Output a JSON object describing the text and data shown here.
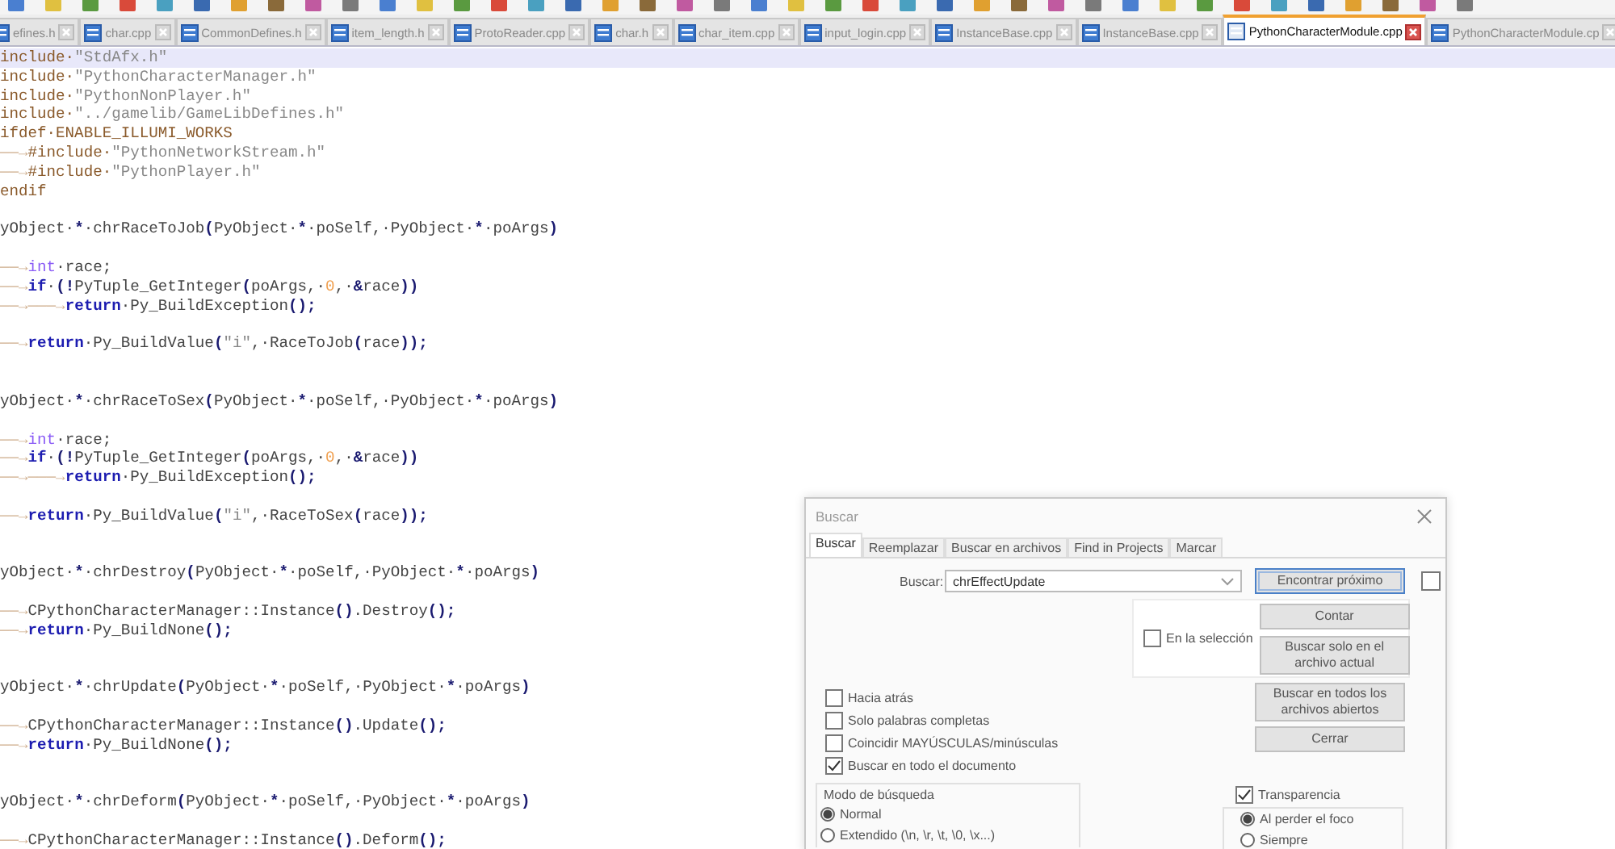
{
  "tabs": [
    {
      "label": "efines.h",
      "selected": false
    },
    {
      "label": "char.cpp",
      "selected": false
    },
    {
      "label": "CommonDefines.h",
      "selected": false
    },
    {
      "label": "item_length.h",
      "selected": false
    },
    {
      "label": "ProtoReader.cpp",
      "selected": false
    },
    {
      "label": "char.h",
      "selected": false
    },
    {
      "label": "char_item.cpp",
      "selected": false
    },
    {
      "label": "input_login.cpp",
      "selected": false
    },
    {
      "label": "InstanceBase.cpp",
      "selected": false
    },
    {
      "label": "InstanceBase.cpp",
      "selected": false
    },
    {
      "label": "PythonCharacterModule.cpp",
      "selected": true
    },
    {
      "label": "PythonCharacterModule.cp",
      "selected": false
    }
  ],
  "code_blocks": [
    {
      "kind": "preprocessor",
      "lines": [
        {
          "current": true,
          "tokens": [
            {
              "kind": "pp",
              "text": "include·"
            },
            {
              "kind": "str",
              "text": "\"StdAfx.h\""
            }
          ]
        },
        {
          "current": false,
          "tokens": [
            {
              "kind": "pp",
              "text": "include·"
            },
            {
              "kind": "str",
              "text": "\"PythonCharacterManager.h\""
            }
          ]
        },
        {
          "current": false,
          "tokens": [
            {
              "kind": "pp",
              "text": "include·"
            },
            {
              "kind": "str",
              "text": "\"PythonNonPlayer.h\""
            }
          ]
        },
        {
          "current": false,
          "tokens": [
            {
              "kind": "pp",
              "text": "include·"
            },
            {
              "kind": "str",
              "text": "\"../gamelib/GameLibDefines.h\""
            }
          ]
        },
        {
          "current": false,
          "tokens": [
            {
              "kind": "pp",
              "text": "ifdef·ENABLE_ILLUMI_WORKS"
            }
          ]
        },
        {
          "current": false,
          "tokens": [
            {
              "kind": "ws",
              "text": "——→"
            },
            {
              "kind": "pp",
              "text": "#include·"
            },
            {
              "kind": "str",
              "text": "\"PythonNetworkStream.h\""
            }
          ]
        },
        {
          "current": false,
          "tokens": [
            {
              "kind": "ws",
              "text": "——→"
            },
            {
              "kind": "pp",
              "text": "#include·"
            },
            {
              "kind": "str",
              "text": "\"PythonPlayer.h\""
            }
          ]
        },
        {
          "current": false,
          "tokens": [
            {
              "kind": "pp",
              "text": "endif"
            }
          ]
        }
      ]
    },
    {
      "kind": "signature",
      "lines": [
        {
          "current": false,
          "tokens": [
            {
              "kind": "text",
              "text": "yObject·"
            },
            {
              "kind": "op",
              "text": "*"
            },
            {
              "kind": "text",
              "text": "·chrRaceToJob"
            },
            {
              "kind": "op",
              "text": "("
            },
            {
              "kind": "text",
              "text": "PyObject·"
            },
            {
              "kind": "op",
              "text": "*"
            },
            {
              "kind": "text",
              "text": "·poSelf,·PyObject·"
            },
            {
              "kind": "op",
              "text": "*"
            },
            {
              "kind": "text",
              "text": "·poArgs"
            },
            {
              "kind": "op",
              "text": ")"
            }
          ]
        }
      ]
    },
    {
      "kind": "body",
      "lines": [
        {
          "current": false,
          "tokens": [
            {
              "kind": "ws",
              "text": "——→"
            },
            {
              "kind": "type",
              "text": "int"
            },
            {
              "kind": "text",
              "text": "·race;"
            }
          ]
        },
        {
          "current": false,
          "tokens": [
            {
              "kind": "ws",
              "text": "——→"
            },
            {
              "kind": "kw",
              "text": "if"
            },
            {
              "kind": "text",
              "text": "·"
            },
            {
              "kind": "op",
              "text": "(!"
            },
            {
              "kind": "text",
              "text": "PyTuple_GetInteger"
            },
            {
              "kind": "op",
              "text": "("
            },
            {
              "kind": "text",
              "text": "poArgs,·"
            },
            {
              "kind": "num",
              "text": "0"
            },
            {
              "kind": "text",
              "text": ",·"
            },
            {
              "kind": "op",
              "text": "&"
            },
            {
              "kind": "text",
              "text": "race"
            },
            {
              "kind": "op",
              "text": "))"
            }
          ]
        },
        {
          "current": false,
          "tokens": [
            {
              "kind": "ws",
              "text": "——→———→"
            },
            {
              "kind": "kw",
              "text": "return"
            },
            {
              "kind": "text",
              "text": "·Py_BuildException"
            },
            {
              "kind": "op",
              "text": "();"
            }
          ]
        }
      ]
    },
    {
      "kind": "body",
      "lines": [
        {
          "current": false,
          "tokens": [
            {
              "kind": "ws",
              "text": "——→"
            },
            {
              "kind": "kw",
              "text": "return"
            },
            {
              "kind": "text",
              "text": "·Py_BuildValue"
            },
            {
              "kind": "op",
              "text": "("
            },
            {
              "kind": "str",
              "text": "\"i\""
            },
            {
              "kind": "text",
              "text": ",·RaceToJob"
            },
            {
              "kind": "op",
              "text": "("
            },
            {
              "kind": "text",
              "text": "race"
            },
            {
              "kind": "op",
              "text": "));"
            }
          ]
        }
      ]
    },
    {
      "kind": "signature",
      "lines": [
        {
          "current": false,
          "tokens": [
            {
              "kind": "text",
              "text": "yObject·"
            },
            {
              "kind": "op",
              "text": "*"
            },
            {
              "kind": "text",
              "text": "·chrRaceToSex"
            },
            {
              "kind": "op",
              "text": "("
            },
            {
              "kind": "text",
              "text": "PyObject·"
            },
            {
              "kind": "op",
              "text": "*"
            },
            {
              "kind": "text",
              "text": "·poSelf,·PyObject·"
            },
            {
              "kind": "op",
              "text": "*"
            },
            {
              "kind": "text",
              "text": "·poArgs"
            },
            {
              "kind": "op",
              "text": ")"
            }
          ]
        }
      ]
    },
    {
      "kind": "body",
      "lines": [
        {
          "current": false,
          "tokens": [
            {
              "kind": "ws",
              "text": "——→"
            },
            {
              "kind": "type",
              "text": "int"
            },
            {
              "kind": "text",
              "text": "·race;"
            }
          ]
        },
        {
          "current": false,
          "tokens": [
            {
              "kind": "ws",
              "text": "——→"
            },
            {
              "kind": "kw",
              "text": "if"
            },
            {
              "kind": "text",
              "text": "·"
            },
            {
              "kind": "op",
              "text": "(!"
            },
            {
              "kind": "text",
              "text": "PyTuple_GetInteger"
            },
            {
              "kind": "op",
              "text": "("
            },
            {
              "kind": "text",
              "text": "poArgs,·"
            },
            {
              "kind": "num",
              "text": "0"
            },
            {
              "kind": "text",
              "text": ",·"
            },
            {
              "kind": "op",
              "text": "&"
            },
            {
              "kind": "text",
              "text": "race"
            },
            {
              "kind": "op",
              "text": "))"
            }
          ]
        },
        {
          "current": false,
          "tokens": [
            {
              "kind": "ws",
              "text": "——→———→"
            },
            {
              "kind": "kw",
              "text": "return"
            },
            {
              "kind": "text",
              "text": "·Py_BuildException"
            },
            {
              "kind": "op",
              "text": "();"
            }
          ]
        }
      ]
    },
    {
      "kind": "body",
      "lines": [
        {
          "current": false,
          "tokens": [
            {
              "kind": "ws",
              "text": "——→"
            },
            {
              "kind": "kw",
              "text": "return"
            },
            {
              "kind": "text",
              "text": "·Py_BuildValue"
            },
            {
              "kind": "op",
              "text": "("
            },
            {
              "kind": "str",
              "text": "\"i\""
            },
            {
              "kind": "text",
              "text": ",·RaceToSex"
            },
            {
              "kind": "op",
              "text": "("
            },
            {
              "kind": "text",
              "text": "race"
            },
            {
              "kind": "op",
              "text": "));"
            }
          ]
        }
      ]
    },
    {
      "kind": "signature",
      "lines": [
        {
          "current": false,
          "tokens": [
            {
              "kind": "text",
              "text": "yObject·"
            },
            {
              "kind": "op",
              "text": "*"
            },
            {
              "kind": "text",
              "text": "·chrDestroy"
            },
            {
              "kind": "op",
              "text": "("
            },
            {
              "kind": "text",
              "text": "PyObject·"
            },
            {
              "kind": "op",
              "text": "*"
            },
            {
              "kind": "text",
              "text": "·poSelf,·PyObject·"
            },
            {
              "kind": "op",
              "text": "*"
            },
            {
              "kind": "text",
              "text": "·poArgs"
            },
            {
              "kind": "op",
              "text": ")"
            }
          ]
        }
      ]
    },
    {
      "kind": "body",
      "lines": [
        {
          "current": false,
          "tokens": [
            {
              "kind": "ws",
              "text": "——→"
            },
            {
              "kind": "text",
              "text": "CPythonCharacterManager::Instance"
            },
            {
              "kind": "op",
              "text": "()"
            },
            {
              "kind": "text",
              "text": ".Destroy"
            },
            {
              "kind": "op",
              "text": "();"
            }
          ]
        },
        {
          "current": false,
          "tokens": [
            {
              "kind": "ws",
              "text": "——→"
            },
            {
              "kind": "kw",
              "text": "return"
            },
            {
              "kind": "text",
              "text": "·Py_BuildNone"
            },
            {
              "kind": "op",
              "text": "();"
            }
          ]
        }
      ]
    },
    {
      "kind": "signature",
      "lines": [
        {
          "current": false,
          "tokens": [
            {
              "kind": "text",
              "text": "yObject·"
            },
            {
              "kind": "op",
              "text": "*"
            },
            {
              "kind": "text",
              "text": "·chrUpdate"
            },
            {
              "kind": "op",
              "text": "("
            },
            {
              "kind": "text",
              "text": "PyObject·"
            },
            {
              "kind": "op",
              "text": "*"
            },
            {
              "kind": "text",
              "text": "·poSelf,·PyObject·"
            },
            {
              "kind": "op",
              "text": "*"
            },
            {
              "kind": "text",
              "text": "·poArgs"
            },
            {
              "kind": "op",
              "text": ")"
            }
          ]
        }
      ]
    },
    {
      "kind": "body",
      "lines": [
        {
          "current": false,
          "tokens": [
            {
              "kind": "ws",
              "text": "——→"
            },
            {
              "kind": "text",
              "text": "CPythonCharacterManager::Instance"
            },
            {
              "kind": "op",
              "text": "()"
            },
            {
              "kind": "text",
              "text": ".Update"
            },
            {
              "kind": "op",
              "text": "();"
            }
          ]
        },
        {
          "current": false,
          "tokens": [
            {
              "kind": "ws",
              "text": "——→"
            },
            {
              "kind": "kw",
              "text": "return"
            },
            {
              "kind": "text",
              "text": "·Py_BuildNone"
            },
            {
              "kind": "op",
              "text": "();"
            }
          ]
        }
      ]
    },
    {
      "kind": "signature",
      "lines": [
        {
          "current": false,
          "tokens": [
            {
              "kind": "text",
              "text": "yObject·"
            },
            {
              "kind": "op",
              "text": "*"
            },
            {
              "kind": "text",
              "text": "·chrDeform"
            },
            {
              "kind": "op",
              "text": "("
            },
            {
              "kind": "text",
              "text": "PyObject·"
            },
            {
              "kind": "op",
              "text": "*"
            },
            {
              "kind": "text",
              "text": "·poSelf,·PyObject·"
            },
            {
              "kind": "op",
              "text": "*"
            },
            {
              "kind": "text",
              "text": "·poArgs"
            },
            {
              "kind": "op",
              "text": ")"
            }
          ]
        }
      ]
    },
    {
      "kind": "body",
      "lines": [
        {
          "current": false,
          "tokens": [
            {
              "kind": "ws",
              "text": "——→"
            },
            {
              "kind": "text",
              "text": "CPythonCharacterManager::Instance"
            },
            {
              "kind": "op",
              "text": "()"
            },
            {
              "kind": "text",
              "text": ".Deform"
            },
            {
              "kind": "op",
              "text": "();"
            }
          ]
        }
      ]
    }
  ],
  "find_dialog": {
    "title": "Buscar",
    "tabs": [
      {
        "label": "Buscar",
        "selected": true
      },
      {
        "label": "Reemplazar",
        "selected": false
      },
      {
        "label": "Buscar en archivos",
        "selected": false
      },
      {
        "label": "Find in Projects",
        "selected": false
      },
      {
        "label": "Marcar",
        "selected": false
      }
    ],
    "search_label": "Buscar:",
    "search_value": "chrEffectUpdate",
    "find_next_button": "Encontrar próximo",
    "extra_checkbox": {
      "checked": false
    },
    "count_button": "Contar",
    "in_selection": {
      "label": "En la selección",
      "checked": false
    },
    "current_file_button": "Buscar solo en el archivo actual",
    "all_files_button": "Buscar en todos los archivos abiertos",
    "close_button": "Cerrar",
    "options": [
      {
        "label": "Hacia atrás",
        "checked": false
      },
      {
        "label": "Solo palabras completas",
        "checked": false
      },
      {
        "label": "Coincidir MAYÚSCULAS/minúsculas",
        "checked": false
      },
      {
        "label": "Buscar en todo el documento",
        "checked": true
      }
    ],
    "search_mode": {
      "title": "Modo de búsqueda",
      "options": [
        {
          "label": "Normal",
          "selected": true
        },
        {
          "label": "Extendido (\\n, \\r, \\t, \\0, \\x...)",
          "selected": false
        }
      ]
    },
    "transparency": {
      "label": "Transparencia",
      "checked": true,
      "options": [
        {
          "label": "Al perder el foco",
          "selected": true
        },
        {
          "label": "Siempre",
          "selected": false
        }
      ]
    }
  }
}
